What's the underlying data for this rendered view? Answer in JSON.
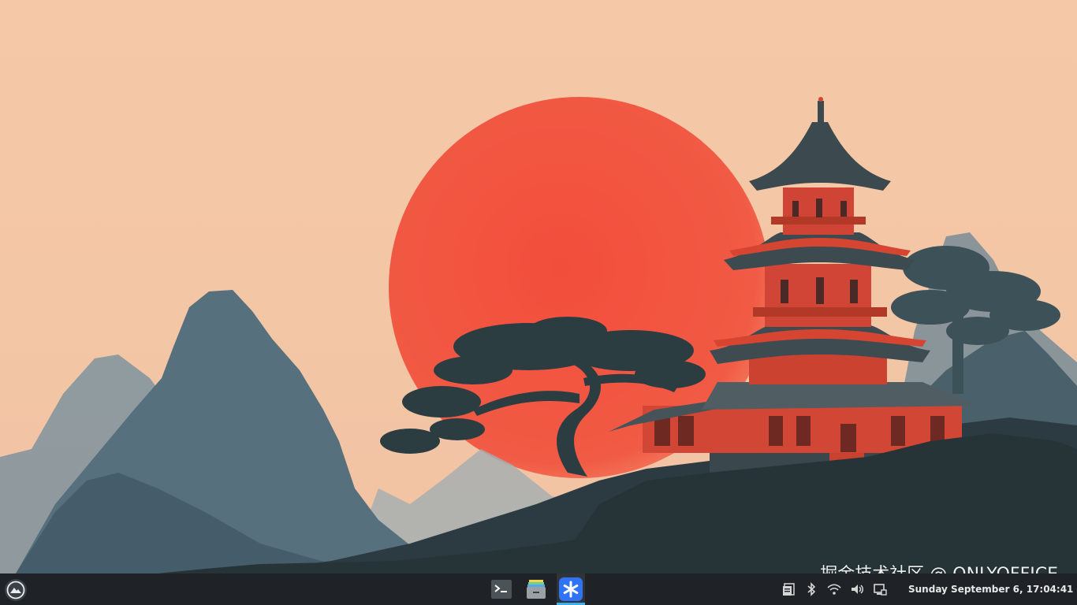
{
  "watermark": "掘金技术社区 @ ONLYOFFICE",
  "taskbar": {
    "launcher_icon": "app-launcher-icon",
    "tasks": [
      {
        "icon": "terminal-icon"
      },
      {
        "icon": "file-manager-icon"
      },
      {
        "icon": "snowflake-app-icon",
        "active": true
      }
    ],
    "tray": [
      "clipboard-icon",
      "bluetooth-icon",
      "wifi-icon",
      "volume-icon",
      "display-icon"
    ],
    "clock": "Sunday September 6, 17:04:41"
  },
  "colors": {
    "sky": "#f4c9a8",
    "sun": "#f2543f",
    "mountain": "#5d7381",
    "tree": "#2d3e43",
    "pagoda_red": "#d64532",
    "taskbar": "#1f2327",
    "accent": "#3daee9"
  }
}
